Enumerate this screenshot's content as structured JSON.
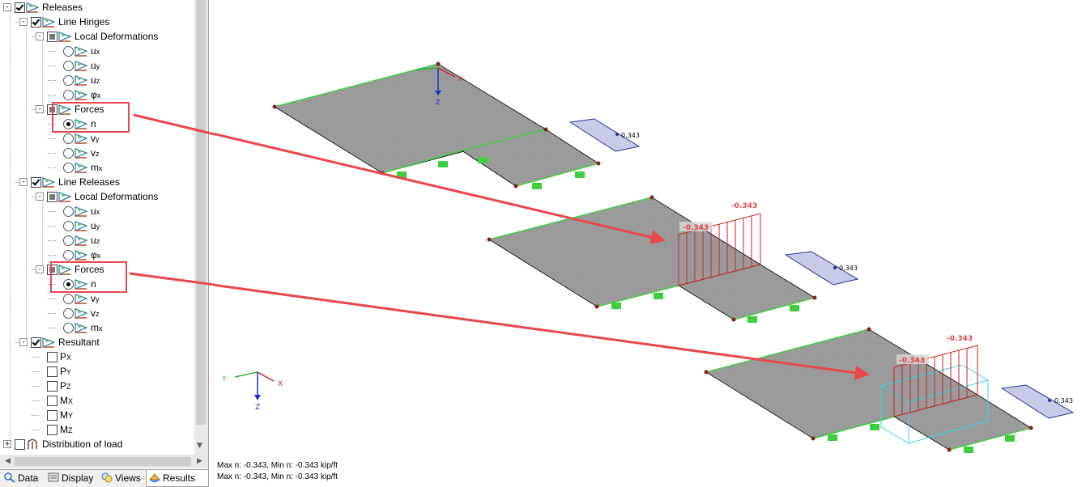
{
  "tree": {
    "releases": "Releases",
    "line_hinges": "Line Hinges",
    "local_deformations_1": "Local Deformations",
    "lh_ld_items": [
      "u",
      "u",
      "u",
      "φ"
    ],
    "lh_ld_subs": [
      "x",
      "y",
      "z",
      "x"
    ],
    "forces_1": "Forces",
    "lh_f_items": [
      "n",
      "v",
      "v",
      "m"
    ],
    "lh_f_subs": [
      "",
      "y",
      "z",
      "x"
    ],
    "line_releases": "Line Releases",
    "local_deformations_2": "Local Deformations",
    "lr_ld_items": [
      "u",
      "u",
      "u",
      "φ"
    ],
    "lr_ld_subs": [
      "x",
      "y",
      "z",
      "x"
    ],
    "forces_2": "Forces",
    "lr_f_items": [
      "n",
      "v",
      "v",
      "m"
    ],
    "lr_f_subs": [
      "",
      "y",
      "z",
      "x"
    ],
    "resultant": "Resultant",
    "resultant_items": [
      "P",
      "P",
      "P",
      "M",
      "M",
      "M"
    ],
    "resultant_subs": [
      "X",
      "Y",
      "Z",
      "X",
      "Y",
      "Z"
    ],
    "distribution": "Distribution of load"
  },
  "tabs": {
    "data": "Data",
    "display": "Display",
    "views": "Views",
    "results": "Results",
    "active": "Results"
  },
  "viewport": {
    "axis_x": "X",
    "axis_y": "Y",
    "axis_z": "Z",
    "value_top_diagram": "-0.343",
    "value_top_left": "-0.343",
    "value_mid_diagram": "-0.343",
    "value_mid_left": "-0.343",
    "legend_value_1": "0.343",
    "legend_value_2": "0.343",
    "legend_value_3": "0.343"
  },
  "status": {
    "line1": "Max n: -0.343, Min n: -0.343 kip/ft",
    "line2": "Max n: -0.343, Min n: -0.343 kip/ft"
  },
  "colors": {
    "highlight": "#e8474c",
    "plate_fill": "#9a9a9a",
    "support": "#4dd94d",
    "edge": "#44cc44",
    "diagram": "#d42020",
    "legend_fill": "#c7cbe8",
    "legend_stroke": "#2a3399"
  }
}
